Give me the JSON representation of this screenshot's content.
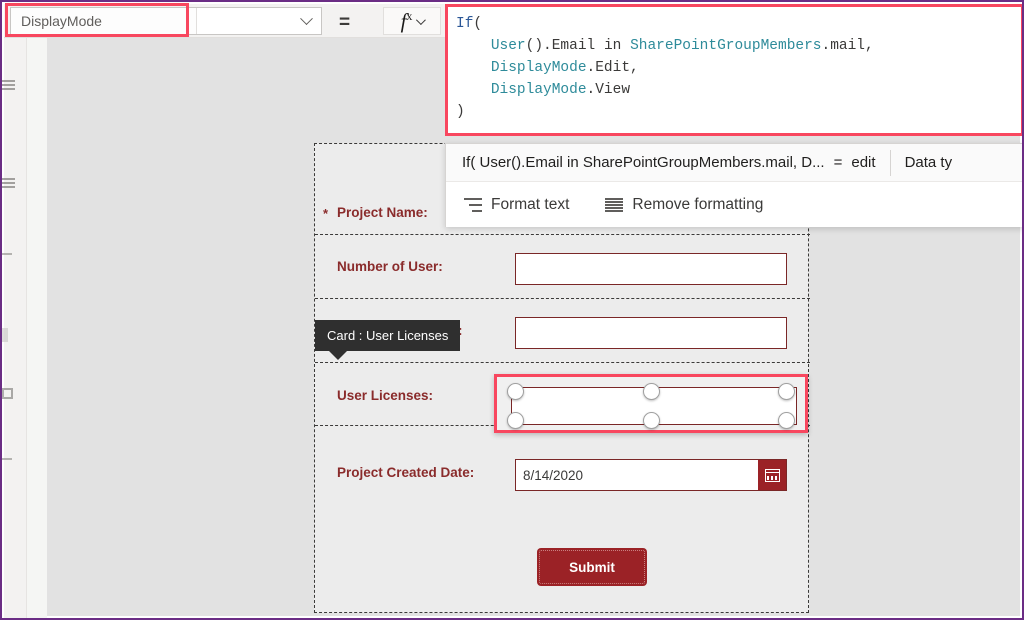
{
  "property_bar": {
    "property_name": "DisplayMode",
    "property_value": "",
    "equals": "=",
    "fx_label": "fx",
    "dropdown_icon": "chevron-down-icon",
    "fx_dropdown_icon": "chevron-down-icon"
  },
  "formula": {
    "line1_fn": "If",
    "line1_paren": "(",
    "line2_a": "User",
    "line2_b": "().",
    "line2_c": "Email",
    "line2_d": " in ",
    "line2_e": "SharePointGroupMembers",
    "line2_f": ".mail,",
    "line3_a": "DisplayMode",
    "line3_b": ".Edit,",
    "line4_a": "DisplayMode",
    "line4_b": ".View",
    "line5": ")"
  },
  "context_popup": {
    "formula_preview": "If( User().Email in SharePointGroupMembers.mail, D...",
    "equals": "=",
    "result_value": "edit",
    "data_type_label": "Data ty",
    "format_text_label": "Format text",
    "remove_formatting_label": "Remove formatting",
    "format_text_icon": "format-text-icon",
    "remove_formatting_icon": "remove-formatting-icon"
  },
  "tooltip": {
    "text": "Card : User Licenses"
  },
  "form": {
    "fields": [
      {
        "label": "Project Name:",
        "required_marker": "*",
        "value": "",
        "control": "text-underline"
      },
      {
        "label": "Number of User:",
        "required_marker": "",
        "value": "",
        "control": "text-box"
      },
      {
        "label": "ts:",
        "required_marker": "",
        "value": "",
        "control": "text-box"
      },
      {
        "label": "User Licenses:",
        "required_marker": "",
        "value": "",
        "control": "radio-group-selected"
      },
      {
        "label": "Project Created Date:",
        "required_marker": "",
        "value": "8/14/2020",
        "control": "date-picker"
      }
    ],
    "date_picker_icon": "calendar-icon",
    "submit_label": "Submit"
  },
  "colors": {
    "highlight_red": "#f8475f",
    "brand_dark_red": "#9b2226",
    "label_red": "#8a2b2b",
    "control_border": "#7a2727",
    "canvas_gray": "#e2e2e2",
    "form_gray": "#ececec",
    "window_border": "#6b2d85",
    "tooltip_bg": "#2f2f2f"
  }
}
